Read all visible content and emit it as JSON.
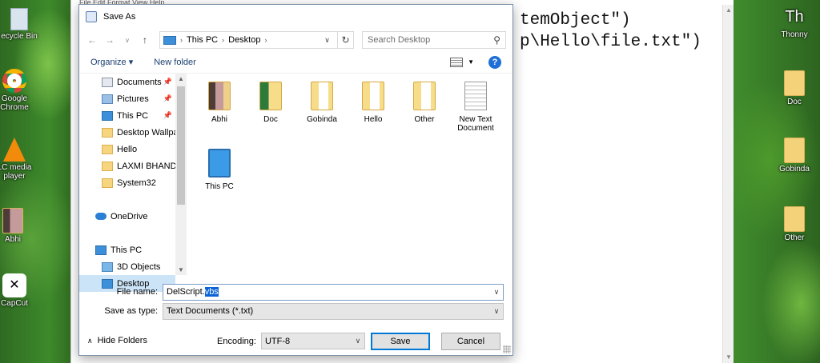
{
  "desktop": {
    "left_icons": [
      {
        "label": "ecycle Bin",
        "icon": "recycle-bin-icon"
      },
      {
        "label": "Google\nChrome",
        "icon": "chrome-icon"
      },
      {
        "label": "LC media\nplayer",
        "icon": "vlc-icon"
      },
      {
        "label": "Abhi",
        "icon": "folder-icon"
      },
      {
        "label": "CapCut",
        "icon": "capcut-icon"
      }
    ],
    "right_icons": [
      {
        "label": "Thonny",
        "icon": "thonny-icon"
      },
      {
        "label": "Doc",
        "icon": "folder-icon"
      },
      {
        "label": "Gobinda",
        "icon": "folder-icon"
      },
      {
        "label": "Other",
        "icon": "folder-icon"
      }
    ]
  },
  "notepad": {
    "menu": "File   Edit   Format   View   Help",
    "code_line1": "temObject\")",
    "code_line2": "p\\Hello\\file.txt\")"
  },
  "dialog": {
    "title": "Save As",
    "address": {
      "crumbs": [
        "This PC",
        "Desktop"
      ]
    },
    "search_placeholder": "Search Desktop",
    "toolbar": {
      "organize": "Organize ▾",
      "new_folder": "New folder",
      "help": "?"
    },
    "nav_items": [
      {
        "label": "Documents",
        "icon": "fi-docs",
        "pin": true,
        "indent": 28
      },
      {
        "label": "Pictures",
        "icon": "fi-pics",
        "pin": true,
        "indent": 28
      },
      {
        "label": "This PC",
        "icon": "fi-pc",
        "pin": true,
        "indent": 28
      },
      {
        "label": "Desktop Wallpap",
        "icon": "fi-folder",
        "pin": false,
        "indent": 28
      },
      {
        "label": "Hello",
        "icon": "fi-folder",
        "pin": false,
        "indent": 28
      },
      {
        "label": "LAXMI BHAND",
        "icon": "fi-folder",
        "pin": false,
        "indent": 28
      },
      {
        "label": "System32",
        "icon": "fi-folder",
        "pin": false,
        "indent": 28
      },
      {
        "label": "",
        "icon": "",
        "pin": false,
        "indent": 28
      },
      {
        "label": "OneDrive",
        "icon": "fi-cloud",
        "pin": false,
        "indent": 20
      },
      {
        "label": "",
        "icon": "",
        "pin": false,
        "indent": 28
      },
      {
        "label": "This PC",
        "icon": "fi-pc",
        "pin": false,
        "indent": 20
      },
      {
        "label": "3D Objects",
        "icon": "fi-3d",
        "pin": false,
        "indent": 28
      },
      {
        "label": "Desktop",
        "icon": "fi-pc",
        "pin": false,
        "indent": 28,
        "selected": true
      }
    ],
    "files": [
      {
        "label": "Abhi",
        "kind": "photo"
      },
      {
        "label": "Doc",
        "kind": "green"
      },
      {
        "label": "Gobinda",
        "kind": "doc"
      },
      {
        "label": "Hello",
        "kind": "doc"
      },
      {
        "label": "Other",
        "kind": "doc"
      },
      {
        "label": "New Text Document",
        "kind": "txt"
      },
      {
        "label": "This PC",
        "kind": "pc"
      }
    ],
    "file_name_label": "File name:",
    "file_name_prefix": "DelScript.",
    "file_name_selected": "vbs",
    "save_as_type_label": "Save as type:",
    "save_as_type_value": "Text Documents (*.txt)",
    "hide_folders": "Hide Folders",
    "encoding_label": "Encoding:",
    "encoding_value": "UTF-8",
    "save_button": "Save",
    "cancel_button": "Cancel"
  }
}
